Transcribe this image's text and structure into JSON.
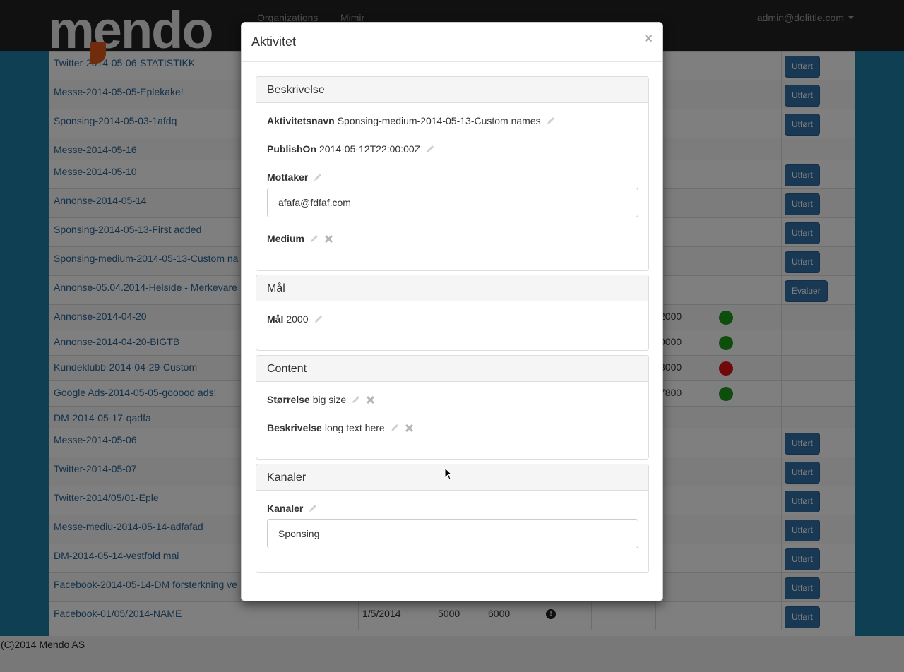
{
  "navbar": {
    "logo": "mendo",
    "links": [
      "Organizations",
      "Mimir"
    ],
    "user": "admin@dolittle.com"
  },
  "table": {
    "rows": [
      {
        "name": "Twitter-2014-05-06-STATISTIKK",
        "button": "Utført"
      },
      {
        "name": "Messe-2014-05-05-Eplekake!",
        "button": "Utført"
      },
      {
        "name": "Sponsing-2014-05-03-1afdq",
        "button": "Utført"
      },
      {
        "name": "Messe-2014-05-16",
        "button": ""
      },
      {
        "name": "Messe-2014-05-10",
        "button": "Utført"
      },
      {
        "name": "Annonse-2014-05-14",
        "button": "Utført"
      },
      {
        "name": "Sponsing-2014-05-13-First added",
        "button": "Utført"
      },
      {
        "name": "Sponsing-medium-2014-05-13-Custom na",
        "button": "Utført"
      },
      {
        "name": "Annonse-05.04.2014-Helside - Merkevare",
        "button": "Evaluer"
      },
      {
        "name": "Annonse-2014-04-20",
        "value": "2000",
        "status": "#1a9c1a"
      },
      {
        "name": "Annonse-2014-04-20-BIGTB",
        "value": "0000",
        "status": "#1a9c1a"
      },
      {
        "name": "Kundeklubb-2014-04-29-Custom",
        "value": "3000",
        "status": "#e01515"
      },
      {
        "name": "Google Ads-2014-05-05-gooood ads!",
        "value": "7800",
        "status": "#1a9c1a"
      },
      {
        "name": "DM-2014-05-17-qadfa",
        "button": ""
      },
      {
        "name": "Messe-2014-05-06",
        "button": "Utført"
      },
      {
        "name": "Twitter-2014-05-07",
        "button": "Utført"
      },
      {
        "name": "Twitter-2014/05/01-Eple",
        "button": "Utført"
      },
      {
        "name": "Messe-mediu-2014-05-14-adfafad",
        "button": "Utført"
      },
      {
        "name": "DM-2014-05-14-vestfold mai",
        "button": "Utført"
      },
      {
        "name": "Facebook-2014-05-14-DM forsterkning ve",
        "button": "Utført"
      },
      {
        "name": "Facebook-01/05/2014-NAME",
        "date": "1/5/2014",
        "v1": "5000",
        "v2": "6000",
        "button": "Utført"
      }
    ]
  },
  "footer": {
    "text": "(C)2014 Mendo AS"
  },
  "modal": {
    "title": "Aktivitet",
    "close": "×",
    "beskrivelse_panel": {
      "heading": "Beskrivelse",
      "aktivitetsnavn_label": "Aktivitetsnavn",
      "aktivitetsnavn_value": "Sponsing-medium-2014-05-13-Custom names",
      "publishon_label": "PublishOn",
      "publishon_value": "2014-05-12T22:00:00Z",
      "mottaker_label": "Mottaker",
      "mottaker_value": "afafa@fdfaf.com",
      "medium_label": "Medium"
    },
    "maal_panel": {
      "heading": "Mål",
      "maal_label": "Mål",
      "maal_value": "2000"
    },
    "content_panel": {
      "heading": "Content",
      "storrelse_label": "Størrelse",
      "storrelse_value": "big size",
      "beskrivelse_label": "Beskrivelse",
      "beskrivelse_value": "long text here"
    },
    "kanaler_panel": {
      "heading": "Kanaler",
      "kanaler_label": "Kanaler",
      "kanaler_value": "Sponsing"
    }
  },
  "colors": {
    "brand_blue": "#1d7fa6",
    "button_blue": "#3071a9",
    "link_blue": "#2a6496"
  }
}
